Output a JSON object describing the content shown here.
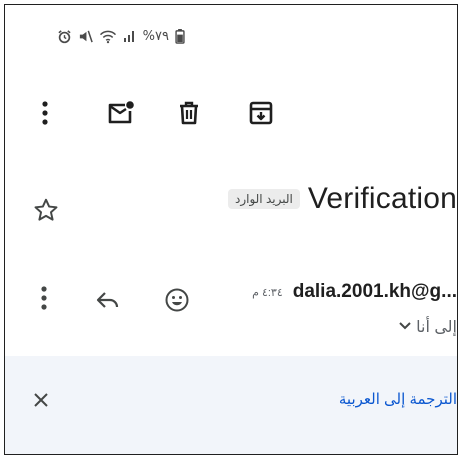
{
  "status_bar": {
    "battery_percent": "%٧٩",
    "icons": [
      "battery-icon",
      "signal-icon",
      "wifi-icon",
      "mute-icon",
      "alarm-icon"
    ]
  },
  "toolbar": {
    "icons": [
      "more-vert-icon",
      "mark-unread-icon",
      "delete-icon",
      "archive-icon"
    ]
  },
  "email": {
    "subject": "Verification",
    "label_chip": "البريد الوارد",
    "sender": "dalia.2001.kh@g...",
    "time": "٤:٣٤ م",
    "recipient": "إلى أنا"
  },
  "translate_bar": {
    "link_text": "الترجمة إلى العربية"
  },
  "colors": {
    "link": "#0b57d0",
    "icon": "#444746",
    "translate_bar_bg": "#f2f5fa",
    "chip_bg": "#ececec"
  }
}
